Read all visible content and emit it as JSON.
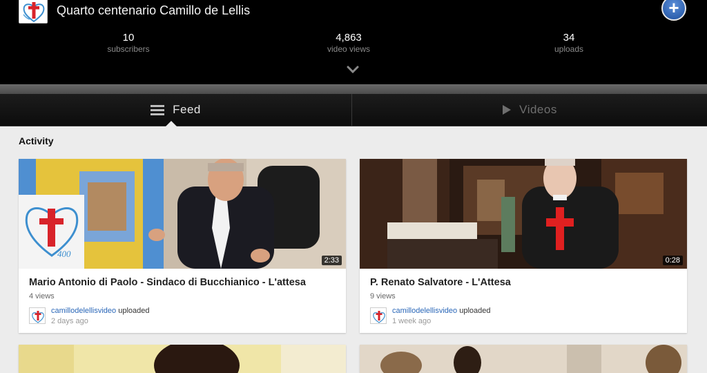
{
  "channel": {
    "title": "Quarto centenario Camillo de Lellis",
    "avatar_icon": "red-cross-heart-logo",
    "subscribe_icon": "plus-icon"
  },
  "stats": [
    {
      "value": "10",
      "label": "subscribers"
    },
    {
      "value": "4,863",
      "label": "video views"
    },
    {
      "value": "34",
      "label": "uploads"
    }
  ],
  "tabs": {
    "feed_label": "Feed",
    "videos_label": "Videos"
  },
  "activity": {
    "heading": "Activity",
    "cards": [
      {
        "title": "Mario Antonio di Paolo - Sindaco di Bucchianico - L'attesa",
        "duration": "2:33",
        "views": "4 views",
        "uploader": "camillodelellisvideo",
        "action": "uploaded",
        "ago": "2 days ago",
        "logo_number": "400"
      },
      {
        "title": "P. Renato Salvatore - L'Attesa",
        "duration": "0:28",
        "views": "9 views",
        "uploader": "camillodelellisvideo",
        "action": "uploaded",
        "ago": "1 week ago"
      }
    ]
  },
  "colors": {
    "header_bg": "#000000",
    "accent_cross": "#d8232a",
    "link": "#2a67b8",
    "plus_button": "#2b63b8"
  }
}
